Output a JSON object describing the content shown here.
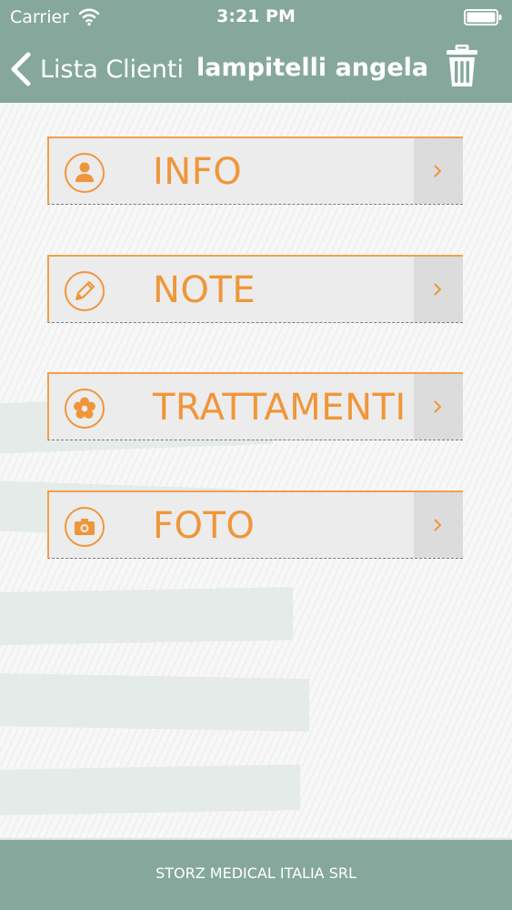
{
  "status_bar": {
    "carrier": "Carrier",
    "time": "3:21 PM",
    "icons": [
      "wifi-icon",
      "battery-icon"
    ]
  },
  "nav": {
    "back_label": "Lista Clienti",
    "title": "lampitelli angela",
    "back_icon": "chevron-left-icon",
    "action_icon": "trash-icon"
  },
  "menu": {
    "items": [
      {
        "label": "INFO",
        "icon": "person-icon"
      },
      {
        "label": "NOTE",
        "icon": "pencil-icon"
      },
      {
        "label": "TRATTAMENTI",
        "icon": "flower-icon"
      },
      {
        "label": "FOTO",
        "icon": "camera-icon"
      }
    ]
  },
  "footer": {
    "text": "STORZ MEDICAL ITALIA SRL"
  },
  "colors": {
    "header_bg": "#86a89c",
    "accent_orange": "#f0963a",
    "item_bg": "#ececec",
    "chevron_cell_bg": "#dcdcdc"
  }
}
